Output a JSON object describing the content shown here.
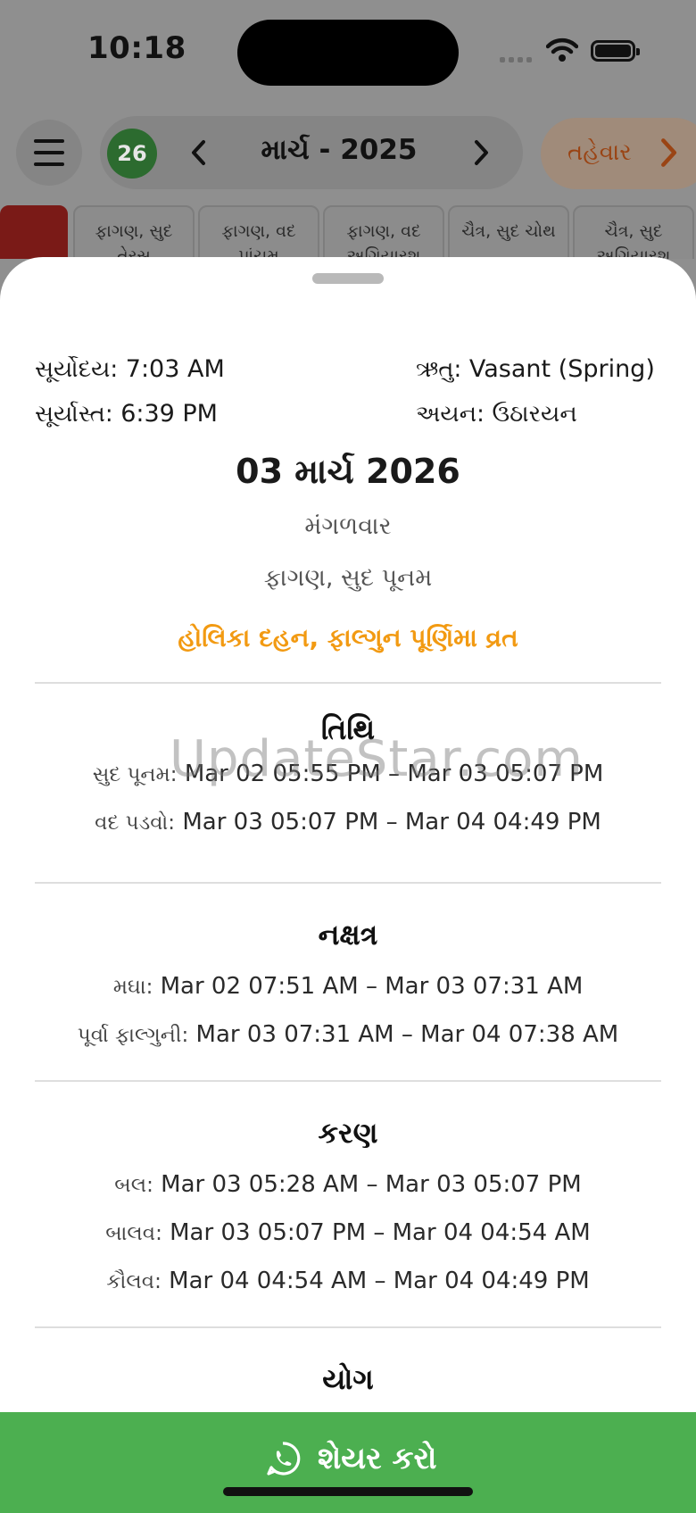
{
  "status_bar": {
    "time": "10:18"
  },
  "nav": {
    "day_badge": "26",
    "month_title": "માર્ચ - 2025",
    "festival_button": "તહેવાર"
  },
  "day_strip": [
    {
      "line1": "",
      "line2": ""
    },
    {
      "line1": "ફાગણ, સુદ",
      "line2": "તેરસ"
    },
    {
      "line1": "ફાગણ, વદ",
      "line2": "પાંચમ"
    },
    {
      "line1": "ફાગણ, વદ",
      "line2": "અગિયારશ"
    },
    {
      "line1": "ચૈત્ર, સુદ ચોથ",
      "line2": ""
    },
    {
      "line1": "ચૈત્ર, સુદ",
      "line2": "અગિયારશ"
    }
  ],
  "sheet": {
    "sunrise_label": "સૂર્યોદય:",
    "sunrise_value": "7:03 AM",
    "sunset_label": "સૂર્યાસ્ત:",
    "sunset_value": "6:39 PM",
    "season_label": "ઋતુ:",
    "season_value": "Vasant (Spring)",
    "ayana_label": "અયન:",
    "ayana_value": "ઉઠારયન",
    "date": "03 માર્ચ 2026",
    "weekday": "મંગળવાર",
    "tithi_name": "ફાગણ, સુદ પૂનમ",
    "festival": "હોલિકા દહન, ફાલ્ગુન પૂર્ણિમા વ્રત",
    "watermark": "UpdateStar.com",
    "sections": {
      "tithi": {
        "title": "તિથિ",
        "rows": [
          {
            "name": "સુદ પૂનમ:",
            "value": "Mar 02 05:55 PM – Mar 03 05:07 PM"
          },
          {
            "name": "વદ પડવો:",
            "value": "Mar 03 05:07 PM – Mar 04 04:49 PM"
          }
        ]
      },
      "nakshatra": {
        "title": "નક્ષત્ર",
        "rows": [
          {
            "name": "મઘા:",
            "value": "Mar 02 07:51 AM – Mar 03 07:31 AM"
          },
          {
            "name": "પૂર્વા ફાલ્ગુની:",
            "value": "Mar 03 07:31 AM – Mar 04 07:38 AM"
          }
        ]
      },
      "karan": {
        "title": "કરણ",
        "rows": [
          {
            "name": "બલ:",
            "value": "Mar 03 05:28 AM – Mar 03 05:07 PM"
          },
          {
            "name": "બાલવ:",
            "value": "Mar 03 05:07 PM – Mar 04 04:54 AM"
          },
          {
            "name": "કૌલવ:",
            "value": "Mar 04 04:54 AM – Mar 04 04:49 PM"
          }
        ]
      },
      "yog": {
        "title": "યોગ"
      }
    }
  },
  "share": {
    "label": "શેયર કરો"
  },
  "colors": {
    "accent_green": "#4caf50",
    "festival_orange": "#f29a12",
    "badge_green": "#2c6b2f",
    "holiday_red": "#7a1a17"
  },
  "icons": [
    "menu-icon",
    "chevron-left-icon",
    "chevron-right-icon",
    "wifi-icon",
    "battery-icon",
    "whatsapp-icon"
  ]
}
